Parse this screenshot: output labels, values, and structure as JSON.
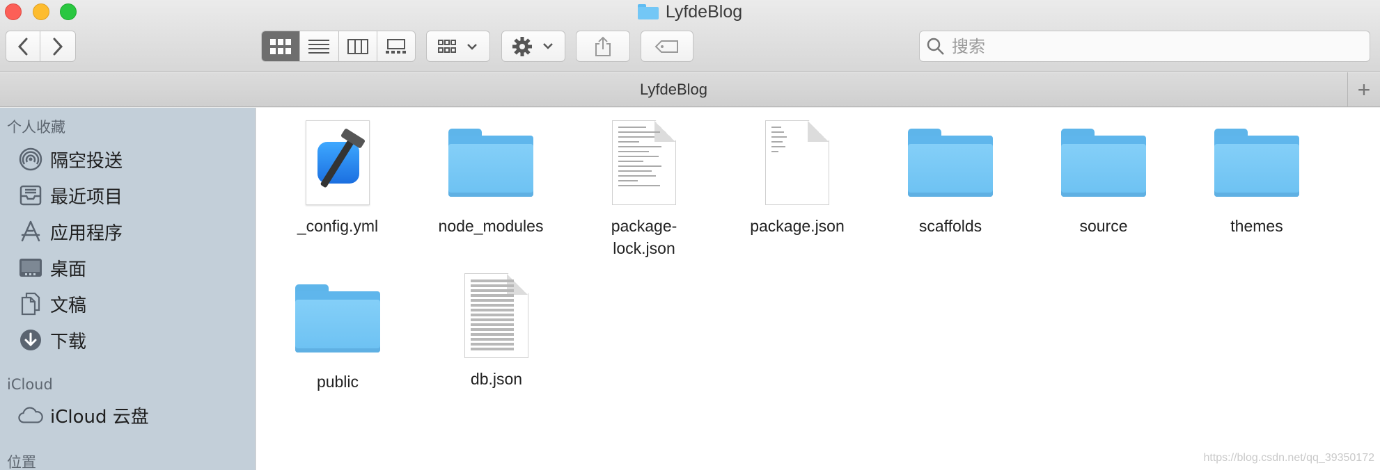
{
  "window": {
    "title": "LyfdeBlog"
  },
  "toolbar": {
    "search_placeholder": "搜索",
    "view_modes": [
      "icon-view",
      "list-view",
      "column-view",
      "gallery-view"
    ],
    "active_view": "icon-view"
  },
  "pathbar": {
    "title": "LyfdeBlog",
    "add_label": "+"
  },
  "sidebar": {
    "favorites_title": "个人收藏",
    "favorites": [
      {
        "label": "隔空投送",
        "icon": "airdrop-icon"
      },
      {
        "label": "最近项目",
        "icon": "recents-icon"
      },
      {
        "label": "应用程序",
        "icon": "applications-icon"
      },
      {
        "label": "桌面",
        "icon": "desktop-icon"
      },
      {
        "label": "文稿",
        "icon": "documents-icon"
      },
      {
        "label": "下载",
        "icon": "downloads-icon"
      }
    ],
    "icloud_title": "iCloud",
    "icloud": [
      {
        "label": "iCloud 云盘",
        "icon": "icloud-icon"
      }
    ],
    "locations_title": "位置"
  },
  "files": [
    {
      "name": "_config.yml",
      "type": "yml"
    },
    {
      "name": "node_modules",
      "type": "folder"
    },
    {
      "name": "package-\nlock.json",
      "type": "doc"
    },
    {
      "name": "package.json",
      "type": "doc"
    },
    {
      "name": "scaffolds",
      "type": "folder"
    },
    {
      "name": "source",
      "type": "folder"
    },
    {
      "name": "themes",
      "type": "folder"
    },
    {
      "name": "public",
      "type": "folder"
    },
    {
      "name": "db.json",
      "type": "doc-dense"
    }
  ],
  "watermark": "https://blog.csdn.net/qq_39350172",
  "colors": {
    "folder": "#73c7f6",
    "sidebar": "#c3cfd9",
    "close": "#fc5f57",
    "minimize": "#fdbc2e",
    "maximize": "#29c740"
  }
}
